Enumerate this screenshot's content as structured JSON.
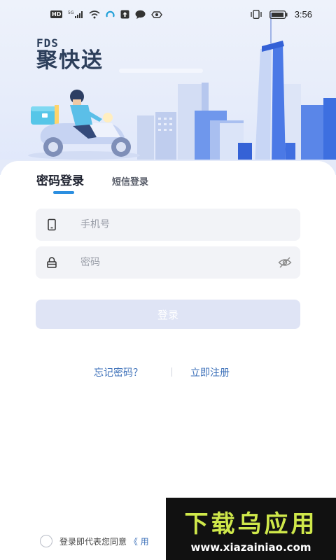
{
  "status_bar": {
    "left_icons": [
      "hd-badge",
      "signal-icon",
      "wifi-icon",
      "app-icon",
      "upload-icon",
      "chat-icon",
      "cloud-icon"
    ],
    "hd_label": "HD",
    "network_label": "5G",
    "time": "3:56",
    "right_icons": [
      "vibrate-icon",
      "battery-icon"
    ]
  },
  "brand": {
    "small": "FDS",
    "name": "聚快送"
  },
  "tabs": [
    {
      "label": "密码登录",
      "active": true
    },
    {
      "label": "短信登录",
      "active": false
    }
  ],
  "form": {
    "phone_placeholder": "手机号",
    "phone_icon": "phone-icon",
    "password_placeholder": "密码",
    "password_icon": "lock-icon",
    "toggle_icon": "eye-hidden-icon",
    "login_label": "登录"
  },
  "links": {
    "forgot": "忘记密码？",
    "separator": "|",
    "register": "立即注册"
  },
  "agreement": {
    "text": "登录即代表您同意",
    "link_prefix": "《 用"
  },
  "watermark": {
    "title": "下载乌应用",
    "url": "www.xiazainiao.com"
  },
  "colors": {
    "accent": "#2c8fe0",
    "link": "#3b6fb8",
    "button_disabled": "#dfe4f5",
    "field_bg": "#f2f3f7",
    "brand_text": "#2c3e5a"
  }
}
